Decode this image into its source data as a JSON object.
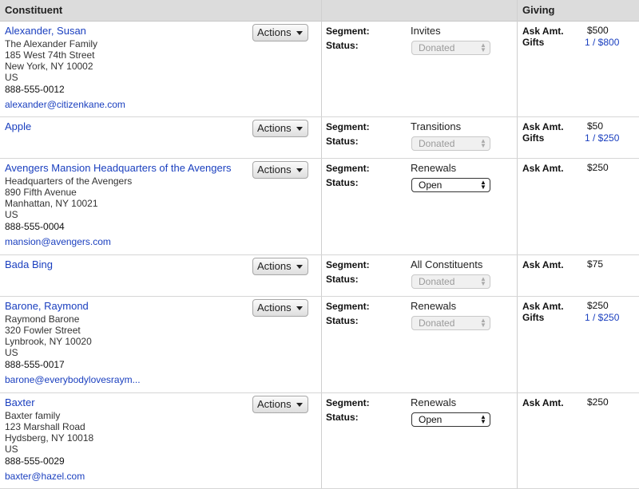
{
  "header": {
    "constituent": "Constituent",
    "giving": "Giving"
  },
  "labels": {
    "actions": "Actions",
    "segment": "Segment:",
    "status": "Status:",
    "ask_amt": "Ask Amt.",
    "gifts": "Gifts"
  },
  "rows": [
    {
      "name": "Alexander, Susan",
      "address": [
        "The Alexander Family",
        "185 West 74th Street",
        "New York, NY 10002",
        "US"
      ],
      "phone": "888-555-0012",
      "email": "alexander@citizenkane.com",
      "segment": "Invites",
      "status": "Donated",
      "status_enabled": false,
      "ask": "$500",
      "gifts": "1 / $800"
    },
    {
      "name": "Apple",
      "address": [],
      "phone": "",
      "email": "",
      "segment": "Transitions",
      "status": "Donated",
      "status_enabled": false,
      "ask": "$50",
      "gifts": "1 / $250"
    },
    {
      "name": "Avengers Mansion Headquarters of the Avengers",
      "address": [
        "Headquarters of the Avengers",
        "890 Fifth Avenue",
        "Manhattan, NY 10021",
        "US"
      ],
      "phone": "888-555-0004",
      "email": "mansion@avengers.com",
      "segment": "Renewals",
      "status": "Open",
      "status_enabled": true,
      "ask": "$250",
      "gifts": ""
    },
    {
      "name": "Bada Bing",
      "address": [],
      "phone": "",
      "email": "",
      "segment": "All Constituents",
      "status": "Donated",
      "status_enabled": false,
      "ask": "$75",
      "gifts": ""
    },
    {
      "name": "Barone, Raymond",
      "address": [
        "Raymond Barone",
        "320 Fowler Street",
        "Lynbrook, NY 10020",
        "US"
      ],
      "phone": "888-555-0017",
      "email": "barone@everybodylovesraym...",
      "segment": "Renewals",
      "status": "Donated",
      "status_enabled": false,
      "ask": "$250",
      "gifts": "1 / $250"
    },
    {
      "name": "Baxter",
      "address": [
        "Baxter family",
        "123 Marshall Road",
        "Hydsberg, NY 10018",
        "US"
      ],
      "phone": "888-555-0029",
      "email": "baxter@hazel.com",
      "segment": "Renewals",
      "status": "Open",
      "status_enabled": true,
      "ask": "$250",
      "gifts": ""
    }
  ]
}
